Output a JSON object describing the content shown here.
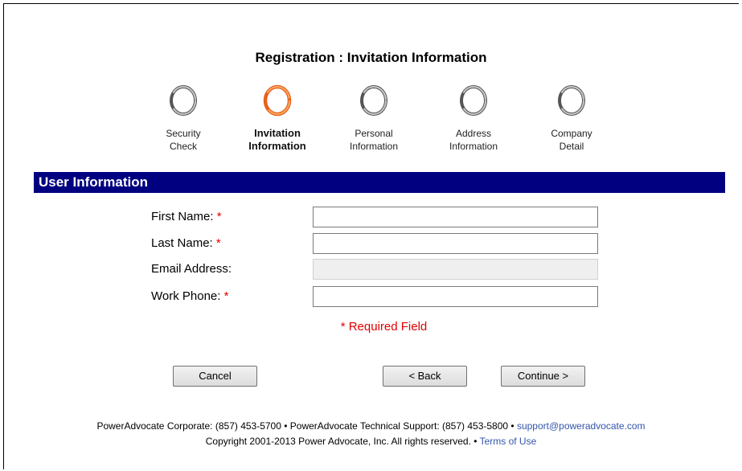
{
  "page": {
    "title": "Registration : Invitation Information"
  },
  "steps": [
    {
      "line1": "Security",
      "line2": "Check",
      "active": false
    },
    {
      "line1": "Invitation",
      "line2": "Information",
      "active": true
    },
    {
      "line1": "Personal",
      "line2": "Information",
      "active": false
    },
    {
      "line1": "Address",
      "line2": "Information",
      "active": false
    },
    {
      "line1": "Company",
      "line2": "Detail",
      "active": false
    }
  ],
  "section": {
    "title": "User Information"
  },
  "form": {
    "first_name": {
      "label": "First Name:",
      "required_mark": "*",
      "value": ""
    },
    "last_name": {
      "label": "Last Name:",
      "required_mark": "*",
      "value": ""
    },
    "email": {
      "label": "Email Address:",
      "value": ""
    },
    "work_phone": {
      "label": "Work Phone:",
      "required_mark": "*",
      "value": ""
    },
    "required_note": "* Required Field"
  },
  "buttons": {
    "cancel": "Cancel",
    "back": "< Back",
    "continue": "Continue >"
  },
  "footer": {
    "line1_text": "PowerAdvocate Corporate: (857) 453-5700 • PowerAdvocate Technical Support: (857) 453-5800 •",
    "support_email": "support@poweradvocate.com",
    "line2_text": "Copyright 2001-2013 Power Advocate, Inc. All rights reserved. •",
    "terms_link": "Terms of Use"
  },
  "colors": {
    "section_bar": "#000080",
    "active_step": "#f07a24",
    "inactive_step": "#8a8a8a",
    "required": "#e00000"
  },
  "icons": {
    "step_marker": "ring-icon"
  }
}
